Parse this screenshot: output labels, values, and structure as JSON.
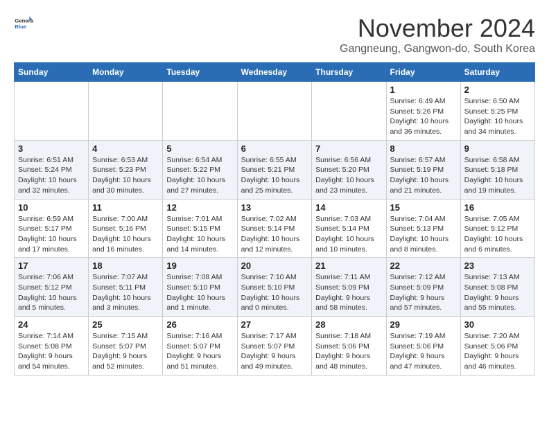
{
  "logo": {
    "general": "General",
    "blue": "Blue"
  },
  "title": "November 2024",
  "location": "Gangneung, Gangwon-do, South Korea",
  "weekdays": [
    "Sunday",
    "Monday",
    "Tuesday",
    "Wednesday",
    "Thursday",
    "Friday",
    "Saturday"
  ],
  "weeks": [
    [
      {
        "day": "",
        "info": ""
      },
      {
        "day": "",
        "info": ""
      },
      {
        "day": "",
        "info": ""
      },
      {
        "day": "",
        "info": ""
      },
      {
        "day": "",
        "info": ""
      },
      {
        "day": "1",
        "info": "Sunrise: 6:49 AM\nSunset: 5:26 PM\nDaylight: 10 hours\nand 36 minutes."
      },
      {
        "day": "2",
        "info": "Sunrise: 6:50 AM\nSunset: 5:25 PM\nDaylight: 10 hours\nand 34 minutes."
      }
    ],
    [
      {
        "day": "3",
        "info": "Sunrise: 6:51 AM\nSunset: 5:24 PM\nDaylight: 10 hours\nand 32 minutes."
      },
      {
        "day": "4",
        "info": "Sunrise: 6:53 AM\nSunset: 5:23 PM\nDaylight: 10 hours\nand 30 minutes."
      },
      {
        "day": "5",
        "info": "Sunrise: 6:54 AM\nSunset: 5:22 PM\nDaylight: 10 hours\nand 27 minutes."
      },
      {
        "day": "6",
        "info": "Sunrise: 6:55 AM\nSunset: 5:21 PM\nDaylight: 10 hours\nand 25 minutes."
      },
      {
        "day": "7",
        "info": "Sunrise: 6:56 AM\nSunset: 5:20 PM\nDaylight: 10 hours\nand 23 minutes."
      },
      {
        "day": "8",
        "info": "Sunrise: 6:57 AM\nSunset: 5:19 PM\nDaylight: 10 hours\nand 21 minutes."
      },
      {
        "day": "9",
        "info": "Sunrise: 6:58 AM\nSunset: 5:18 PM\nDaylight: 10 hours\nand 19 minutes."
      }
    ],
    [
      {
        "day": "10",
        "info": "Sunrise: 6:59 AM\nSunset: 5:17 PM\nDaylight: 10 hours\nand 17 minutes."
      },
      {
        "day": "11",
        "info": "Sunrise: 7:00 AM\nSunset: 5:16 PM\nDaylight: 10 hours\nand 16 minutes."
      },
      {
        "day": "12",
        "info": "Sunrise: 7:01 AM\nSunset: 5:15 PM\nDaylight: 10 hours\nand 14 minutes."
      },
      {
        "day": "13",
        "info": "Sunrise: 7:02 AM\nSunset: 5:14 PM\nDaylight: 10 hours\nand 12 minutes."
      },
      {
        "day": "14",
        "info": "Sunrise: 7:03 AM\nSunset: 5:14 PM\nDaylight: 10 hours\nand 10 minutes."
      },
      {
        "day": "15",
        "info": "Sunrise: 7:04 AM\nSunset: 5:13 PM\nDaylight: 10 hours\nand 8 minutes."
      },
      {
        "day": "16",
        "info": "Sunrise: 7:05 AM\nSunset: 5:12 PM\nDaylight: 10 hours\nand 6 minutes."
      }
    ],
    [
      {
        "day": "17",
        "info": "Sunrise: 7:06 AM\nSunset: 5:12 PM\nDaylight: 10 hours\nand 5 minutes."
      },
      {
        "day": "18",
        "info": "Sunrise: 7:07 AM\nSunset: 5:11 PM\nDaylight: 10 hours\nand 3 minutes."
      },
      {
        "day": "19",
        "info": "Sunrise: 7:08 AM\nSunset: 5:10 PM\nDaylight: 10 hours\nand 1 minute."
      },
      {
        "day": "20",
        "info": "Sunrise: 7:10 AM\nSunset: 5:10 PM\nDaylight: 10 hours\nand 0 minutes."
      },
      {
        "day": "21",
        "info": "Sunrise: 7:11 AM\nSunset: 5:09 PM\nDaylight: 9 hours\nand 58 minutes."
      },
      {
        "day": "22",
        "info": "Sunrise: 7:12 AM\nSunset: 5:09 PM\nDaylight: 9 hours\nand 57 minutes."
      },
      {
        "day": "23",
        "info": "Sunrise: 7:13 AM\nSunset: 5:08 PM\nDaylight: 9 hours\nand 55 minutes."
      }
    ],
    [
      {
        "day": "24",
        "info": "Sunrise: 7:14 AM\nSunset: 5:08 PM\nDaylight: 9 hours\nand 54 minutes."
      },
      {
        "day": "25",
        "info": "Sunrise: 7:15 AM\nSunset: 5:07 PM\nDaylight: 9 hours\nand 52 minutes."
      },
      {
        "day": "26",
        "info": "Sunrise: 7:16 AM\nSunset: 5:07 PM\nDaylight: 9 hours\nand 51 minutes."
      },
      {
        "day": "27",
        "info": "Sunrise: 7:17 AM\nSunset: 5:07 PM\nDaylight: 9 hours\nand 49 minutes."
      },
      {
        "day": "28",
        "info": "Sunrise: 7:18 AM\nSunset: 5:06 PM\nDaylight: 9 hours\nand 48 minutes."
      },
      {
        "day": "29",
        "info": "Sunrise: 7:19 AM\nSunset: 5:06 PM\nDaylight: 9 hours\nand 47 minutes."
      },
      {
        "day": "30",
        "info": "Sunrise: 7:20 AM\nSunset: 5:06 PM\nDaylight: 9 hours\nand 46 minutes."
      }
    ]
  ]
}
